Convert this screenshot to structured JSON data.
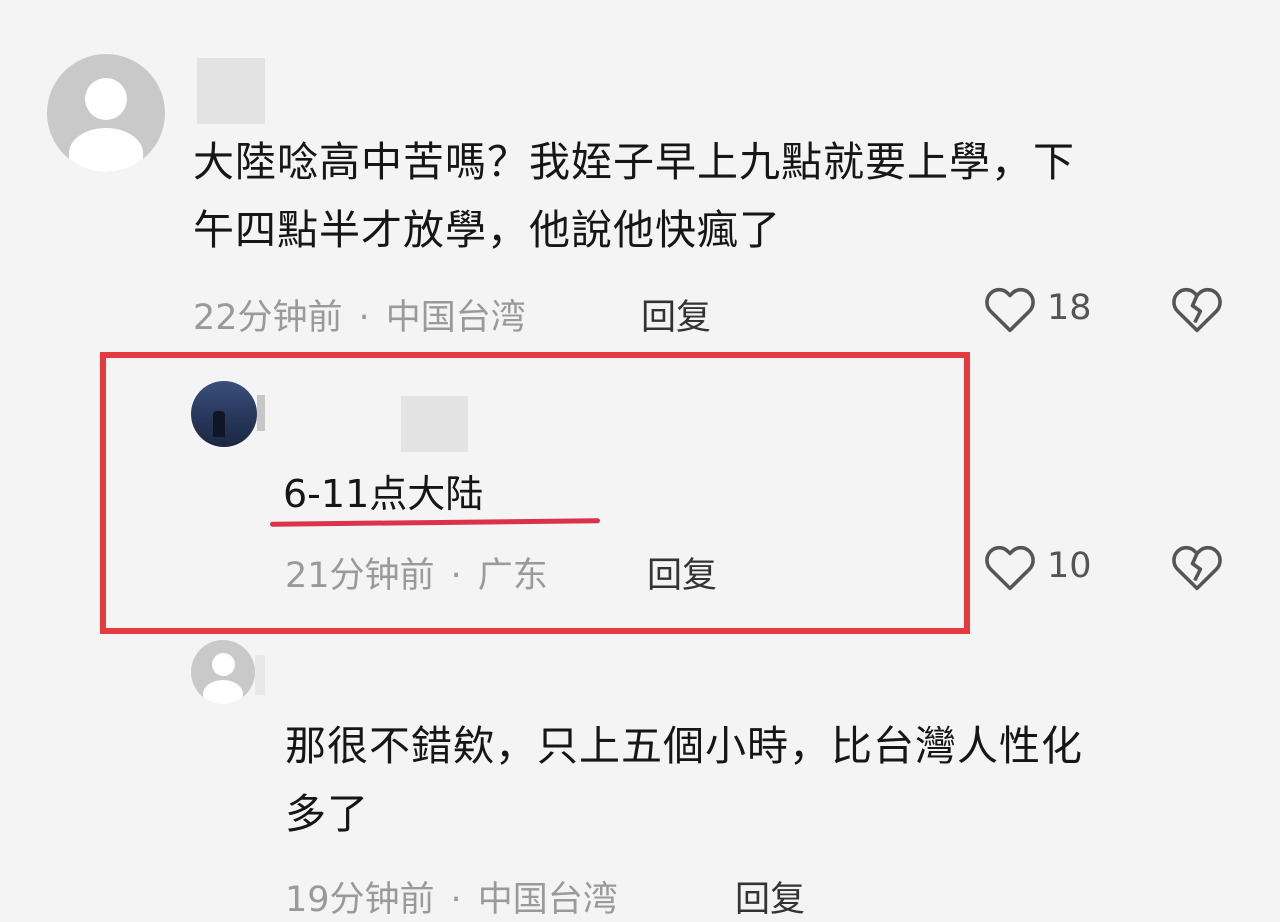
{
  "comments": [
    {
      "text_line1": "大陸唸高中苦嗎？我姪子早上九點就要上學，下",
      "text_line2": "午四點半才放學，他說他快瘋了",
      "time": "22分钟前",
      "sep": "·",
      "location": "中国台湾",
      "reply_label": "回复",
      "likes": "18"
    },
    {
      "text": "6-11点大陆",
      "time": "21分钟前",
      "sep": "·",
      "location": "广东",
      "reply_label": "回复",
      "likes": "10"
    },
    {
      "text_line1": "那很不錯欸，只上五個小時，比台灣人性化",
      "text_line2": "多了",
      "time": "19分钟前",
      "sep": "·",
      "location": "中国台湾",
      "reply_label": "回复"
    }
  ],
  "icons": {
    "like": "heart-outline-icon",
    "dislike": "broken-heart-icon"
  },
  "colors": {
    "highlight": "#e53b3f",
    "underline": "#d9324a"
  }
}
